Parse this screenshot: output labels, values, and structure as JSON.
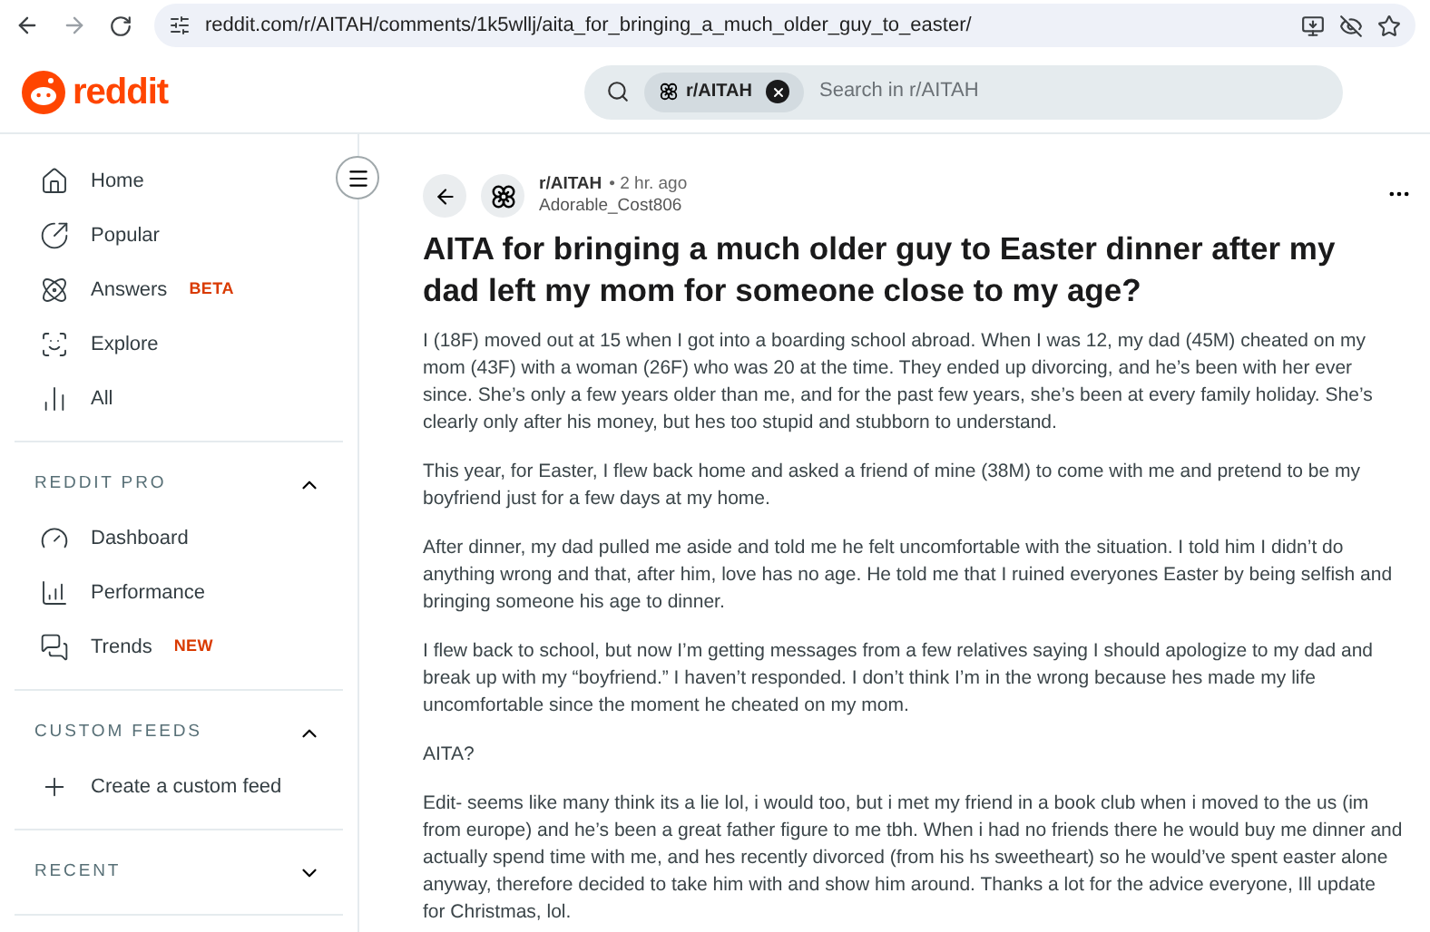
{
  "browser": {
    "url": "reddit.com/r/AITAH/comments/1k5wllj/aita_for_bringing_a_much_older_guy_to_easter/"
  },
  "header": {
    "logo_text": "reddit",
    "search": {
      "chip": "r/AITAH",
      "placeholder": "Search in r/AITAH"
    }
  },
  "sidebar": {
    "items": [
      {
        "label": "Home"
      },
      {
        "label": "Popular"
      },
      {
        "label": "Answers",
        "badge": "BETA"
      },
      {
        "label": "Explore"
      },
      {
        "label": "All"
      }
    ],
    "sections": [
      {
        "title": "REDDIT PRO",
        "expanded": true,
        "items": [
          {
            "label": "Dashboard"
          },
          {
            "label": "Performance"
          },
          {
            "label": "Trends",
            "badge": "NEW"
          }
        ]
      },
      {
        "title": "CUSTOM FEEDS",
        "expanded": true,
        "items": [
          {
            "label": "Create a custom feed"
          }
        ]
      },
      {
        "title": "RECENT",
        "expanded": false
      }
    ]
  },
  "post": {
    "subreddit": "r/AITAH",
    "time": "• 2 hr. ago",
    "author": "Adorable_Cost806",
    "title": "AITA for bringing a much older guy to Easter dinner after my dad left my mom for someone close to my age?",
    "paragraphs": [
      "I (18F) moved out at 15 when I got into a boarding school abroad. When I was 12, my dad (45M) cheated on my mom (43F) with a woman (26F) who was 20 at the time. They ended up divorcing, and he’s been with her ever since. She’s only a few years older than me, and for the past few years, she’s been at every family holiday. She’s clearly only after his money, but hes too stupid and stubborn to understand.",
      "This year, for Easter, I flew back home and asked a friend of mine (38M) to come with me and pretend to be my boyfriend just for a few days at my home.",
      "After dinner, my dad pulled me aside and told me he felt uncomfortable with the situation. I told him I didn’t do anything wrong and that, after him, love has no age. He told me that I ruined everyones Easter by being selfish and bringing someone his age to dinner.",
      "I flew back to school, but now I’m getting messages from a few relatives saying I should apologize to my dad and break up with my “boyfriend.” I haven’t responded. I don’t think I’m in the wrong because hes made my life uncomfortable since the moment he cheated on my mom.",
      "AITA?",
      "Edit- seems like many think its a lie lol, i would too, but i met my friend in a book club when i moved to the us (im from europe) and he’s been a great father figure to me tbh. When i had no friends there he would buy me dinner and actually spend time with me, and hes recently divorced (from his hs sweetheart) so he would’ve spent easter alone anyway, therefore decided to take him with and show him around. Thanks a lot for the advice everyone, Ill update for Christmas, lol."
    ]
  }
}
